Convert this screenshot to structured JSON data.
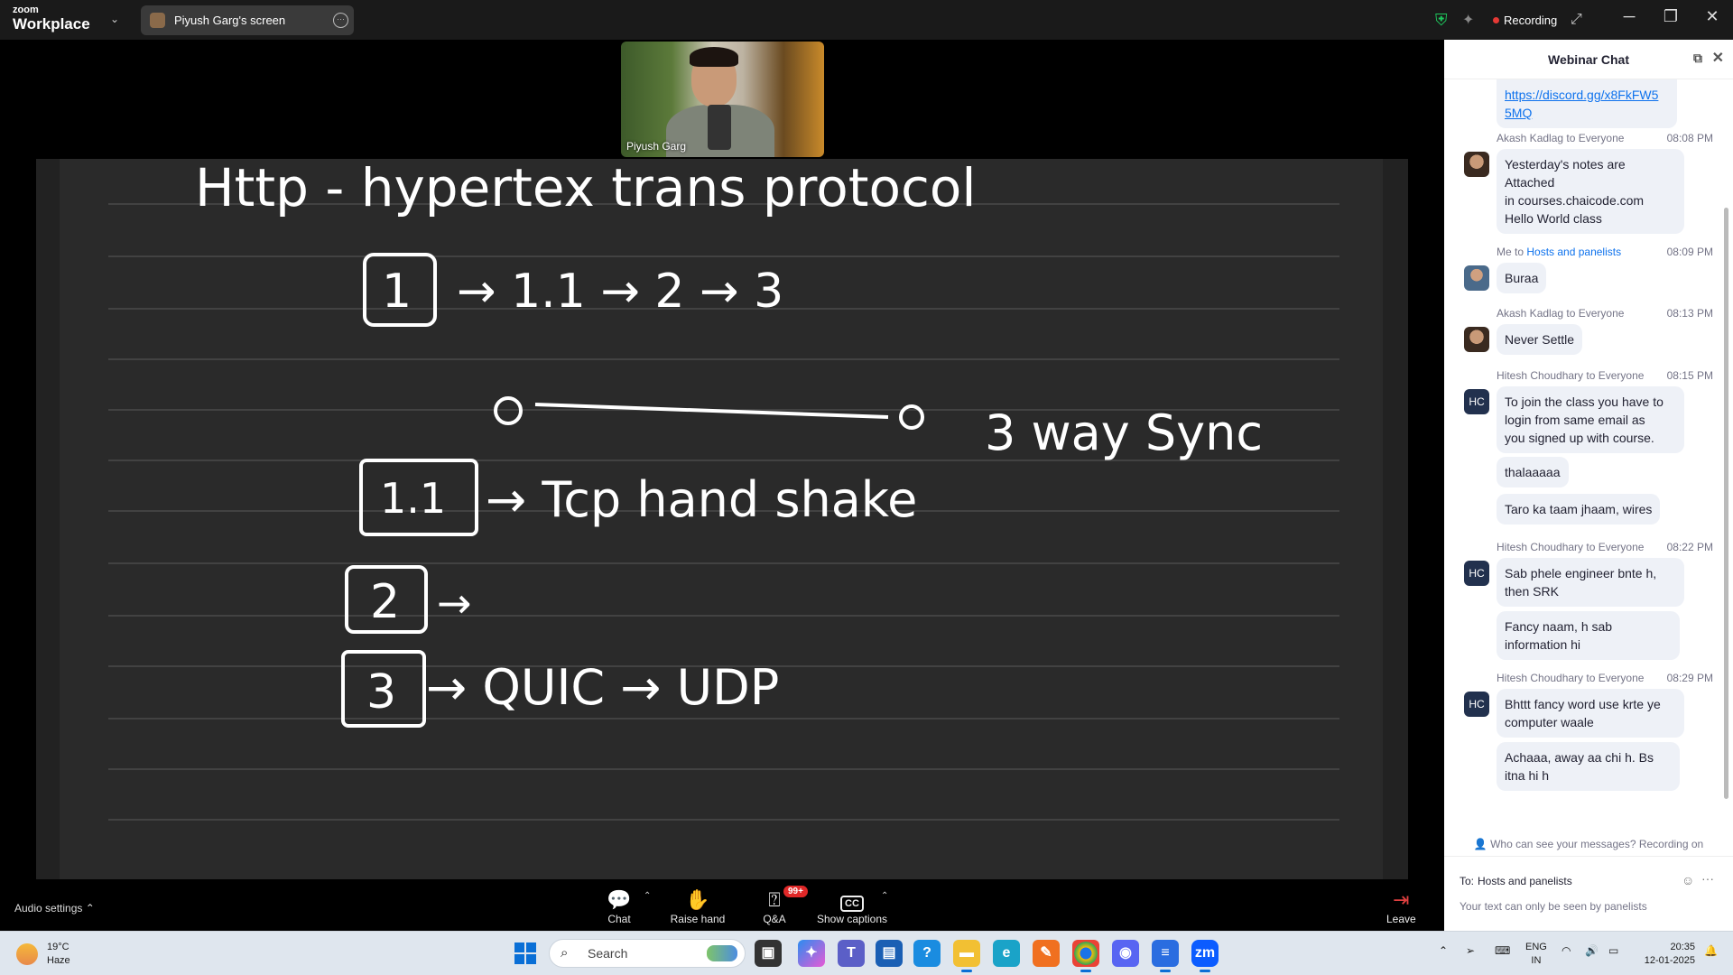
{
  "app": {
    "brand_small": "zoom",
    "brand_name": "Workplace"
  },
  "share": {
    "label": "Piyush Garg's screen"
  },
  "topbar": {
    "recording_label": "Recording"
  },
  "video": {
    "participant_name": "Piyush Garg"
  },
  "board": {
    "lines": [
      "Http - hypertex trans protocol",
      "1 → 1.1 → 2 → 3",
      "o———————o   3 way Sync",
      "1.1 → Tcp  hand shake",
      "2 →",
      "3 → QUIC → UDP"
    ]
  },
  "toolbar": {
    "audio_settings": "Audio settings",
    "chat": "Chat",
    "raise_hand": "Raise hand",
    "qa": "Q&A",
    "qa_badge": "99+",
    "captions": "Show captions",
    "leave": "Leave"
  },
  "chat": {
    "title": "Webinar Chat",
    "messages": [
      {
        "link_line1": "https://discord.gg/x8FkFW5",
        "link_line2": "5MQ"
      },
      {
        "sender": "Akash Kadlag to Everyone",
        "time": "08:08 PM",
        "lines": [
          "Yesterday's notes are",
          "Attached",
          "in courses.chaicode.com",
          "Hello World class"
        ]
      },
      {
        "sender_prefix": "Me to ",
        "sender_target": "Hosts and panelists",
        "time": "08:09 PM",
        "text": "Buraa"
      },
      {
        "sender": "Akash Kadlag to Everyone",
        "time": "08:13 PM",
        "text": "Never Settle"
      },
      {
        "sender": "Hitesh Choudhary to Everyone",
        "time": "08:15 PM",
        "avatar": "HC",
        "lines": [
          "To join the class you have to",
          "login from same email as",
          "you signed up with course."
        ],
        "extra1": "thalaaaaa",
        "extra2": "Taro ka taam jhaam, wires"
      },
      {
        "sender": "Hitesh Choudhary to Everyone",
        "time": "08:22 PM",
        "avatar": "HC",
        "lines": [
          "Sab phele engineer bnte h,",
          "then SRK"
        ],
        "extra_lines": [
          "Fancy naam, h sab",
          "information hi"
        ]
      },
      {
        "sender": "Hitesh Choudhary to Everyone",
        "time": "08:29 PM",
        "avatar": "HC",
        "lines": [
          "Bhttt fancy word use krte ye",
          "computer waale"
        ],
        "extra_lines": [
          "Achaaa, away aa chi h. Bs",
          "itna hi h"
        ]
      }
    ],
    "visibility_note": "Who can see your messages? Recording on",
    "to_label": "To:",
    "to_target": "Hosts and panelists",
    "placeholder": "Your text can only be seen by panelists"
  },
  "taskbar": {
    "temp": "19°C",
    "weather": "Haze",
    "search_placeholder": "Search",
    "lang1": "ENG",
    "lang2": "IN",
    "time": "20:35",
    "date": "12-01-2025"
  },
  "colors": {
    "accent": "#0e72ed",
    "recording": "#e53935",
    "board": "#2a2a2a",
    "chat_bubble": "#eef1f7"
  }
}
